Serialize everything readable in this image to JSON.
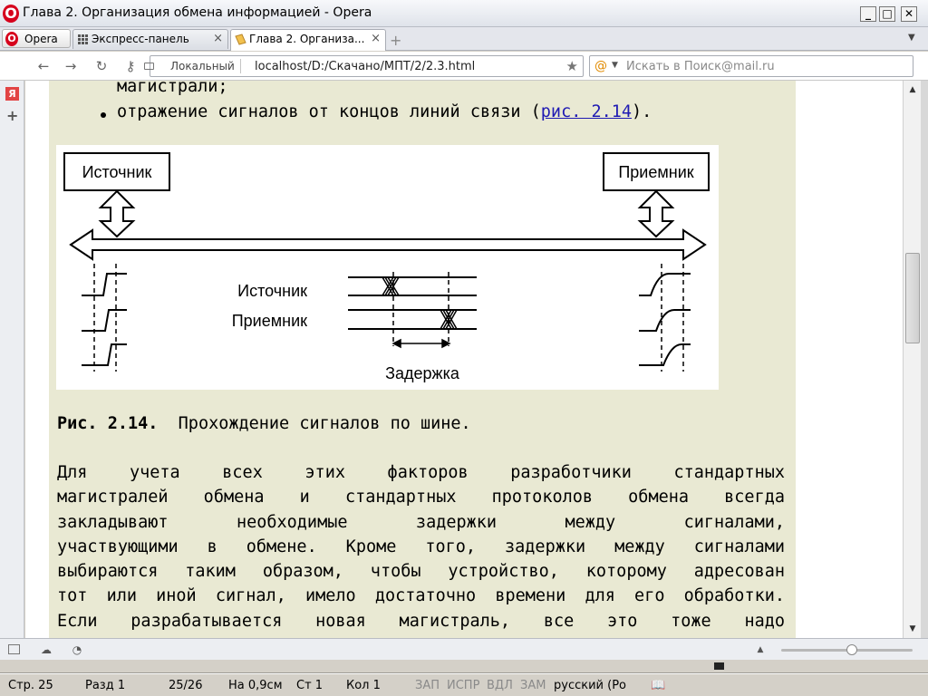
{
  "window": {
    "title": "Глава 2. Организация обмена информацией - Opera",
    "logo": "O",
    "controls": {
      "minimize": "_",
      "maximize": "□",
      "close": "✕"
    }
  },
  "tabs": {
    "opera_menu": "Opera",
    "items": [
      {
        "label": "Экспресс-панель",
        "icon": "speed-dial-grid-icon",
        "close": "×"
      },
      {
        "label": "Глава 2. Организа...",
        "icon": "page-icon",
        "close": "×"
      }
    ],
    "new_tab": "+",
    "tab_menu": "▼"
  },
  "toolbar": {
    "back": "←",
    "forward": "→",
    "reload": "↻",
    "key": "⚷",
    "local_label": "Локальный",
    "url": "localhost/D:/Скачано/МПТ/2/2.3.html",
    "bookmark_star": "★",
    "search_placeholder": "Искать в Поиск@mail.ru"
  },
  "sidebar": {
    "yandex": "Я",
    "add": "+"
  },
  "document": {
    "bullet_1_cont": "магистрали;",
    "bullet_2_text": "отражение сигналов от концов линий связи (",
    "bullet_2_link": "рис. 2.14",
    "bullet_2_end": ").",
    "figure": {
      "source_box": "Источник",
      "receiver_box": "Приемник",
      "source_label": "Источник",
      "receiver_label": "Приемник",
      "delay_label": "Задержка"
    },
    "caption_num": "Рис. 2.14.",
    "caption_text": "Прохождение сигналов по шине.",
    "paragraph_lines": [
      "Для учета всех этих факторов разработчики стандартных",
      "магистралей обмена и стандартных протоколов обмена всегда",
      "закладывают необходимые задержки между сигналами,",
      "участвующими в обмене. Кроме того, задержки между сигналами",
      "выбираются таким образом, чтобы устройство, которому адресован",
      "тот или иной сигнал, имело достаточно времени для его обработки.",
      "Если разрабатывается новая магистраль, все это тоже надо"
    ]
  },
  "scrollbar": {
    "up": "▲",
    "down": "▼"
  },
  "word_status": {
    "page": "Стр. 25",
    "section": "Разд 1",
    "pages": "25/26",
    "at": "На 0,9см",
    "line": "Ст 1",
    "col": "Кол 1",
    "rec": "ЗАП",
    "trk": "ИСПР",
    "ext": "ВДЛ",
    "ovr": "ЗАМ",
    "lang": "русский (Ро"
  }
}
